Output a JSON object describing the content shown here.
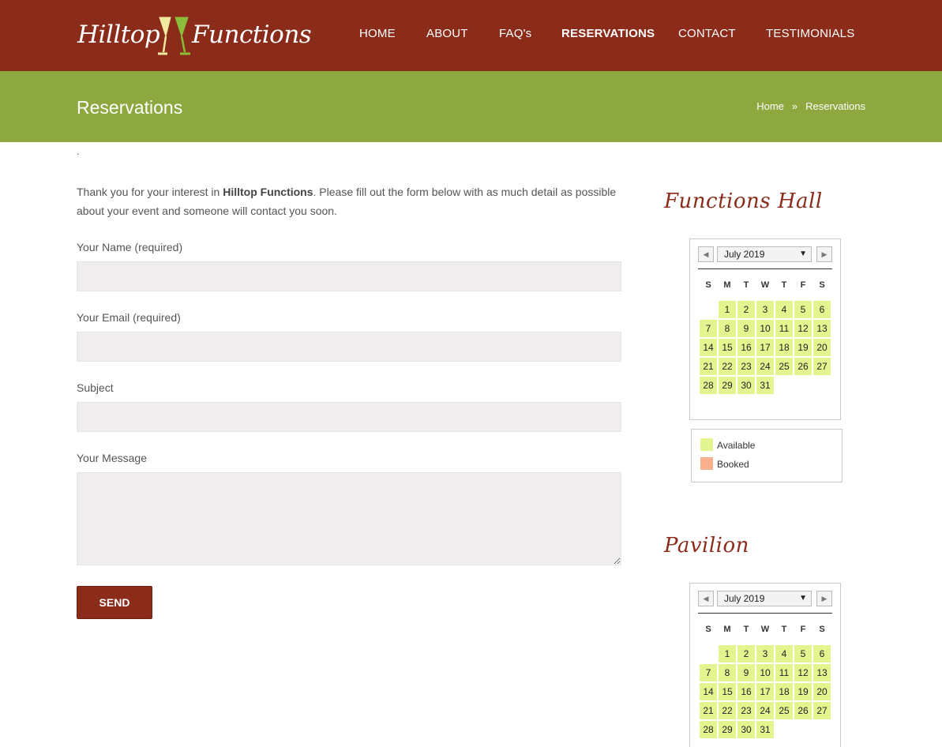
{
  "brand": {
    "left": "Hilltop",
    "right": "Functions"
  },
  "nav": [
    {
      "label": "HOME",
      "active": false
    },
    {
      "label": "ABOUT",
      "active": false
    },
    {
      "label": "FAQ's",
      "active": false
    },
    {
      "label": "RESERVATIONS",
      "active": true
    },
    {
      "label": "CONTACT",
      "active": false
    },
    {
      "label": "TESTIMONIALS",
      "active": false
    }
  ],
  "titlebar": {
    "title": "Reservations",
    "breadcrumb": {
      "home": "Home",
      "separator": "»",
      "current": "Reservations"
    }
  },
  "content": {
    "dot": ".",
    "intro_before": "Thank you for your interest in ",
    "intro_bold": "Hilltop Functions",
    "intro_after": ". Please fill out the form below with as much detail as possible about your event and someone will contact you soon."
  },
  "form": {
    "name_label": "Your Name (required)",
    "name_value": "",
    "email_label": "Your Email (required)",
    "email_value": "",
    "subject_label": "Subject",
    "subject_value": "",
    "message_label": "Your Message",
    "message_value": "",
    "send_label": "SEND"
  },
  "sidebar": {
    "calendars": [
      {
        "title": "Functions Hall",
        "month": "July 2019",
        "weekdays": [
          "S",
          "M",
          "T",
          "W",
          "T",
          "F",
          "S"
        ],
        "first_weekday": 1,
        "days": 31
      },
      {
        "title": "Pavilion",
        "month": "July 2019",
        "weekdays": [
          "S",
          "M",
          "T",
          "W",
          "T",
          "F",
          "S"
        ],
        "first_weekday": 1,
        "days": 31
      }
    ],
    "legend": {
      "available": "Available",
      "booked": "Booked"
    }
  },
  "colors": {
    "header": "#8b2c1b",
    "titlebar": "#8ca83f",
    "available": "#e3f58f",
    "booked": "#f9b08e"
  }
}
